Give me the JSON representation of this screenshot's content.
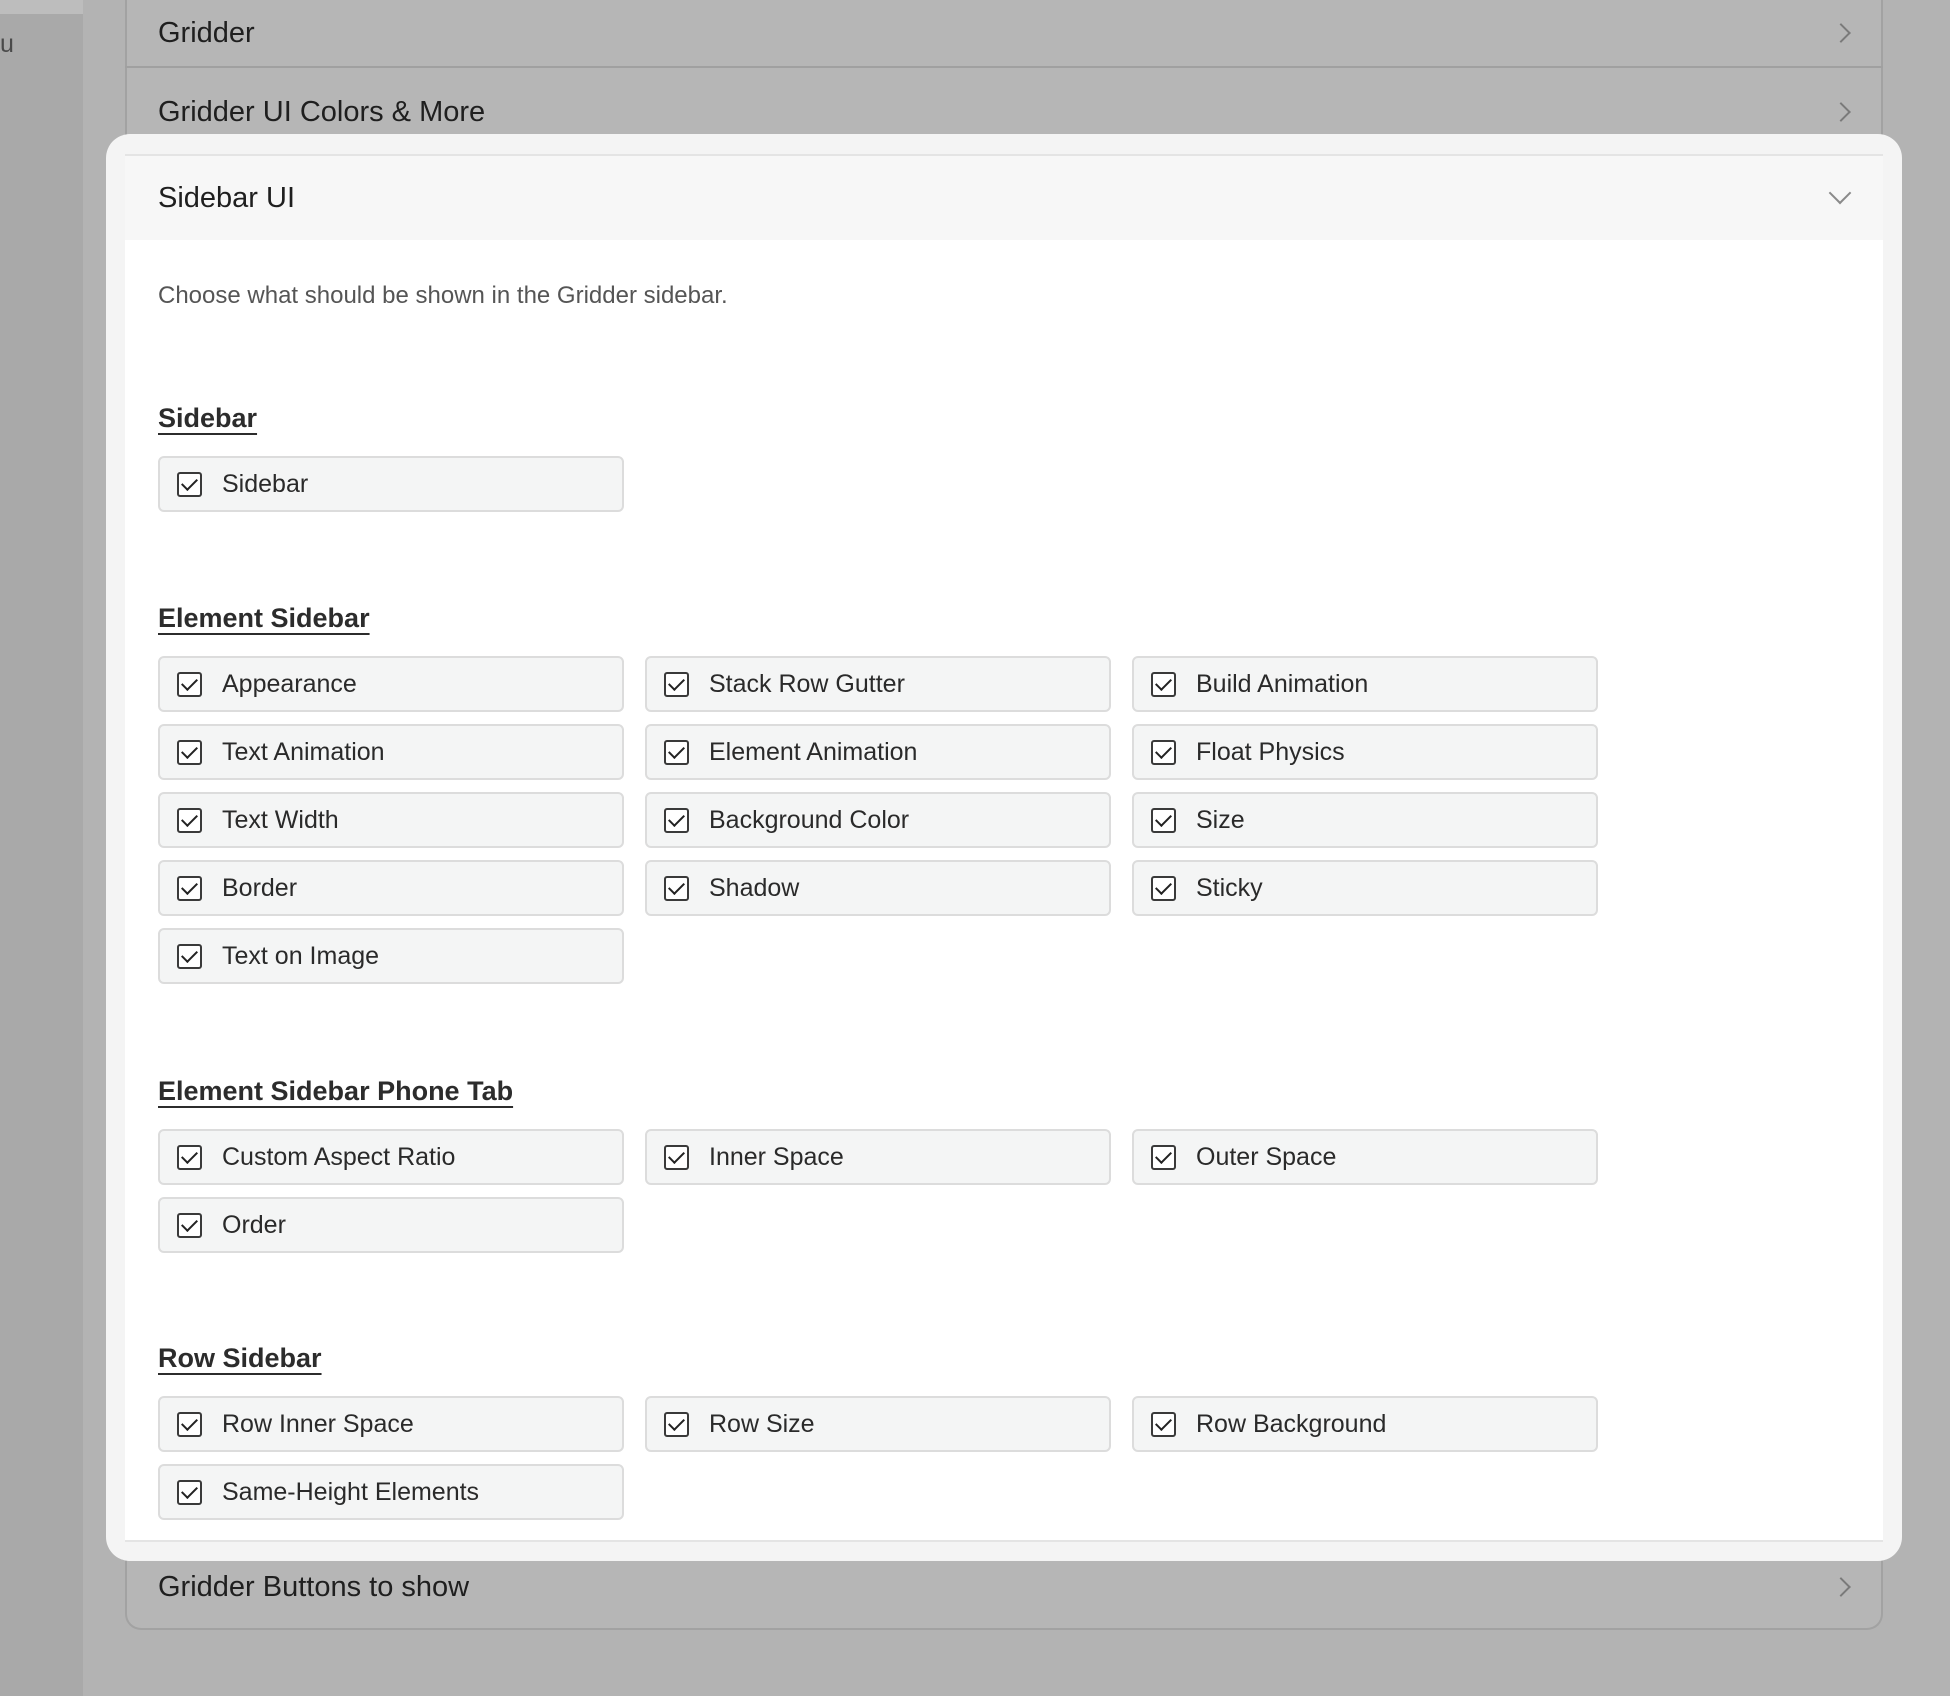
{
  "background": {
    "left_letter": "u",
    "panels": [
      {
        "label": "Gridder"
      },
      {
        "label": "Gridder UI Colors & More"
      },
      {
        "label": "Gridder Buttons to show"
      }
    ]
  },
  "section": {
    "title": "Sidebar UI",
    "description": "Choose what should be shown in the Gridder sidebar."
  },
  "groups": [
    {
      "title": "Sidebar",
      "options": [
        {
          "label": "Sidebar",
          "checked": true
        }
      ]
    },
    {
      "title": "Element Sidebar",
      "options": [
        {
          "label": "Appearance",
          "checked": true
        },
        {
          "label": "Stack Row Gutter",
          "checked": true
        },
        {
          "label": "Build Animation",
          "checked": true
        },
        {
          "label": "Text Animation",
          "checked": true
        },
        {
          "label": "Element Animation",
          "checked": true
        },
        {
          "label": "Float Physics",
          "checked": true
        },
        {
          "label": "Text Width",
          "checked": true
        },
        {
          "label": "Background Color",
          "checked": true
        },
        {
          "label": "Size",
          "checked": true
        },
        {
          "label": "Border",
          "checked": true
        },
        {
          "label": "Shadow",
          "checked": true
        },
        {
          "label": "Sticky",
          "checked": true
        },
        {
          "label": "Text on Image",
          "checked": true
        }
      ]
    },
    {
      "title": "Element Sidebar Phone Tab",
      "options": [
        {
          "label": "Custom Aspect Ratio",
          "checked": true
        },
        {
          "label": "Inner Space",
          "checked": true
        },
        {
          "label": "Outer Space",
          "checked": true
        },
        {
          "label": "Order",
          "checked": true
        }
      ]
    },
    {
      "title": "Row Sidebar",
      "options": [
        {
          "label": "Row Inner Space",
          "checked": true
        },
        {
          "label": "Row Size",
          "checked": true
        },
        {
          "label": "Row Background",
          "checked": true
        },
        {
          "label": "Same-Height Elements",
          "checked": true
        }
      ]
    }
  ]
}
